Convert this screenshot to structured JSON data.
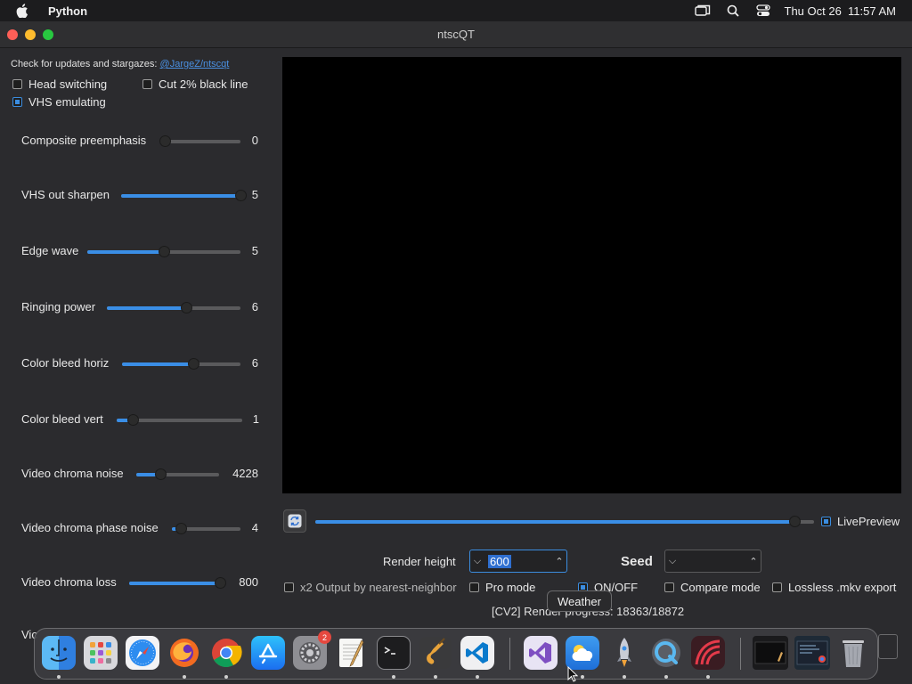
{
  "menubar": {
    "app_name": "Python",
    "datetime": "Thu Oct 26  11:57 AM",
    "icons": [
      "apple-icon",
      "window-icon",
      "search-icon",
      "control-center-icon"
    ]
  },
  "window": {
    "title": "ntscQT",
    "update_text": "Check for updates and stargazes:",
    "update_link": "@JargeZ/ntscqt"
  },
  "options": {
    "head_switching": {
      "label": "Head switching",
      "checked": false
    },
    "cut_black": {
      "label": "Cut 2% black line",
      "checked": false
    },
    "vhs_emulating": {
      "label": "VHS emulating",
      "checked": true
    }
  },
  "sliders": [
    {
      "label": "Composite preemphasis",
      "value": "0",
      "fraction": 0.0
    },
    {
      "label": "VHS out sharpen",
      "value": "5",
      "fraction": 1.0
    },
    {
      "label": "Edge wave",
      "value": "5",
      "fraction": 0.5
    },
    {
      "label": "Ringing power",
      "value": "6",
      "fraction": 0.59
    },
    {
      "label": "Color bleed horiz",
      "value": "6",
      "fraction": 0.6
    },
    {
      "label": "Color bleed vert",
      "value": "1",
      "fraction": 0.13
    },
    {
      "label": "Video chroma noise",
      "value": "4228",
      "fraction": 0.29
    },
    {
      "label": "Video chroma phase noise",
      "value": "4",
      "fraction": 0.13
    },
    {
      "label": "Video chroma loss",
      "value": "800",
      "fraction": 1.0
    }
  ],
  "truncated_label": "Vic",
  "preview": {
    "live_preview_label": "LivePreview",
    "live_preview_checked": true,
    "timeline_fraction": 0.96
  },
  "render": {
    "height_label": "Render height",
    "height_value": "600",
    "seed_label": "Seed",
    "seed_value": ""
  },
  "bottom_options": {
    "x2_output": {
      "label": "x2 Output by nearest-neighbor",
      "checked": false
    },
    "pro_mode": {
      "label": "Pro mode",
      "checked": false
    },
    "on_off": {
      "label": "ON/OFF",
      "checked": true
    },
    "compare_mode": {
      "label": "Compare mode",
      "checked": false
    },
    "lossless": {
      "label": "Lossless .mkv export",
      "checked": false
    }
  },
  "progress_text": "[CV2] Render progress: 18363/18872",
  "tooltip": "Weather",
  "dock": {
    "apps": [
      {
        "name": "finder-icon",
        "running": true
      },
      {
        "name": "launchpad-icon",
        "running": false
      },
      {
        "name": "safari-icon",
        "running": false
      },
      {
        "name": "firefox-icon",
        "running": true
      },
      {
        "name": "chrome-icon",
        "running": true
      },
      {
        "name": "app-store-icon",
        "running": false
      },
      {
        "name": "system-settings-icon",
        "running": false,
        "badge": "2"
      },
      {
        "name": "textedit-icon",
        "running": false
      },
      {
        "name": "terminal-icon",
        "running": true
      },
      {
        "name": "garageband-icon",
        "running": true
      },
      {
        "name": "vscode-icon",
        "running": true
      },
      {
        "name": "visual-studio-icon",
        "running": false
      },
      {
        "name": "weather-icon",
        "running": true
      },
      {
        "name": "python-rocket-icon",
        "running": true
      },
      {
        "name": "quicktime-icon",
        "running": true
      },
      {
        "name": "davinci-icon",
        "running": true
      },
      {
        "name": "recent-window-1-icon",
        "running": false
      },
      {
        "name": "recent-window-2-icon",
        "running": false
      },
      {
        "name": "trash-icon",
        "running": false
      }
    ]
  },
  "colors": {
    "accent": "#3a8ee6",
    "window_bg": "#2b2b2e",
    "preview_bg": "#000000"
  }
}
